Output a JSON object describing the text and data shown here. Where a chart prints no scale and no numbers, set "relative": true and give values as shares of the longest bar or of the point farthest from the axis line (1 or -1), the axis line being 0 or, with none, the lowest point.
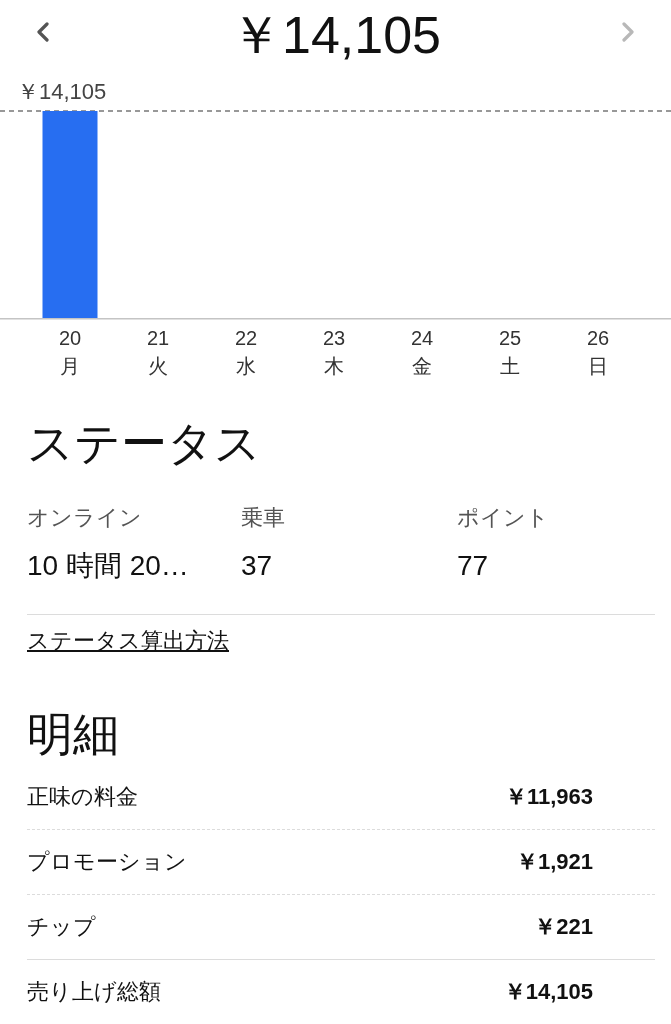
{
  "header": {
    "total": "￥14,105",
    "prev_button": {
      "disabled": false
    },
    "next_button": {
      "disabled": true
    }
  },
  "chart": {
    "chart_data": {
      "type": "bar",
      "relative": true,
      "categories": [
        "20\n月",
        "21\n火",
        "22\n水",
        "23\n木",
        "24\n金",
        "25\n土",
        "26\n日"
      ],
      "values": [
        1,
        0,
        0,
        0,
        0,
        0,
        0
      ],
      "annotations": [
        {
          "text": "￥14,105"
        }
      ]
    }
  },
  "status": {
    "title": "ステータス",
    "metrics": [
      {
        "label": "オンライン",
        "value": "10 時間 20…"
      },
      {
        "label": "乗車",
        "value": "37"
      },
      {
        "label": "ポイント",
        "value": "77"
      }
    ],
    "link": "ステータス算出方法"
  },
  "breakdown": {
    "title": "明細",
    "rows": [
      {
        "label": "正味の料金",
        "amount": "￥11,963"
      },
      {
        "label": "プロモーション",
        "amount": "￥1,921"
      },
      {
        "label": "チップ",
        "amount": "￥221"
      }
    ],
    "total": {
      "label": "売り上げ総額",
      "amount": "￥14,105"
    }
  }
}
